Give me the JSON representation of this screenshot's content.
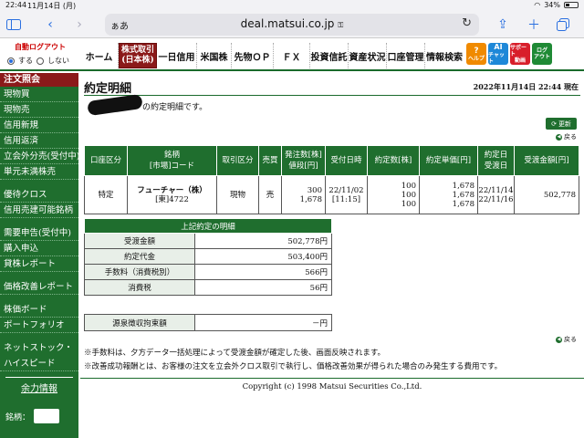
{
  "status": {
    "time": "22:44",
    "date": "11月14日 (月)",
    "battery": "34%",
    "battery_level": 0.34
  },
  "browser": {
    "aa": "ぁあ",
    "url": "deal.matsui.co.jp",
    "lock": "🔒"
  },
  "topnav": {
    "logout_title": "自動ログアウト",
    "radio_on": "する",
    "radio_off": "しない",
    "home": "ホーム",
    "active_line1": "株式取引",
    "active_line2": "(日本株)",
    "items": [
      "一日信用",
      "米国株",
      "先物ＯＰ",
      "ＦＸ",
      "投資信託",
      "資産状況",
      "口座管理",
      "情報検索"
    ],
    "buttons": [
      {
        "label1": "?",
        "label2": "ヘルプ",
        "color": "#f08a00"
      },
      {
        "label1": "AI",
        "label2": "チャット",
        "color": "#1e88d8"
      },
      {
        "label1": "サポート",
        "label2": "動画",
        "color": "#d81e2a"
      },
      {
        "label1": "ログ",
        "label2": "アウト",
        "color": "#1f8a35"
      }
    ]
  },
  "sidebar": {
    "head": "注文照会",
    "group1": [
      "現物買",
      "現物売",
      "信用新規",
      "信用返済",
      "立会外分売(受付中)",
      "単元未満株売"
    ],
    "group2": [
      "優待クロス",
      "信用売建可能銘柄"
    ],
    "group3": [
      "需要申告(受付中)",
      "購入申込",
      "貸株レポート"
    ],
    "group4": [
      "価格改善レポート"
    ],
    "group5": [
      "株価ボード",
      "ポートフォリオ"
    ],
    "group6": [
      "ネットストック・",
      "ハイスピード"
    ],
    "yoryoku": "余力情報",
    "meigara": "銘柄："
  },
  "main": {
    "title": "約定明細",
    "datetime": "2022年11月14日 22:44 現在",
    "intro": "の約定明細です。",
    "refresh": "更新",
    "back": "戻る",
    "table": {
      "headers": [
        [
          "口座区分"
        ],
        [
          "銘柄",
          "[市場]コード"
        ],
        [
          "取引区分"
        ],
        [
          "売買"
        ],
        [
          "発注数[株]",
          "値段[円]"
        ],
        [
          "受付日時"
        ],
        [
          "約定数[株]"
        ],
        [
          "約定単価[円]"
        ],
        [
          "約定日",
          "受渡日"
        ],
        [
          "受渡金額[円]"
        ]
      ],
      "row": {
        "account": "特定",
        "name": "フューチャー（株）",
        "code": "[東]4722",
        "trade_type": "現物",
        "side": "売",
        "order_qty": "300",
        "order_price": "1,678",
        "received_date": "22/11/02",
        "received_time": "[11:15]",
        "exec_qty": [
          "100",
          "100",
          "100"
        ],
        "exec_price": [
          "1,678",
          "1,678",
          "1,678"
        ],
        "exec_date": "22/11/14",
        "settle_date": "22/11/16",
        "amount": "502,778"
      }
    },
    "summary": {
      "title": "上記約定の明細",
      "rows": [
        {
          "label": "受渡金額",
          "value": "502,778円"
        },
        {
          "label": "約定代金",
          "value": "503,400円"
        },
        {
          "label": "手数料（消費税別）",
          "value": "566円"
        },
        {
          "label": "消費税",
          "value": "56円"
        }
      ],
      "withholding_label": "源泉徴収拘束額",
      "withholding_value": "－円"
    },
    "notes": [
      "※手数料は、夕方データ一括処理によって受渡金額が確定した後、画面反映されます。",
      "※改善成功報酬とは、お客様の注文を立会外クロス取引で執行し、価格改善効果が得られた場合のみ発生する費用です。"
    ],
    "copyright": "Copyright (c) 1998 Matsui Securities Co.,Ltd."
  }
}
